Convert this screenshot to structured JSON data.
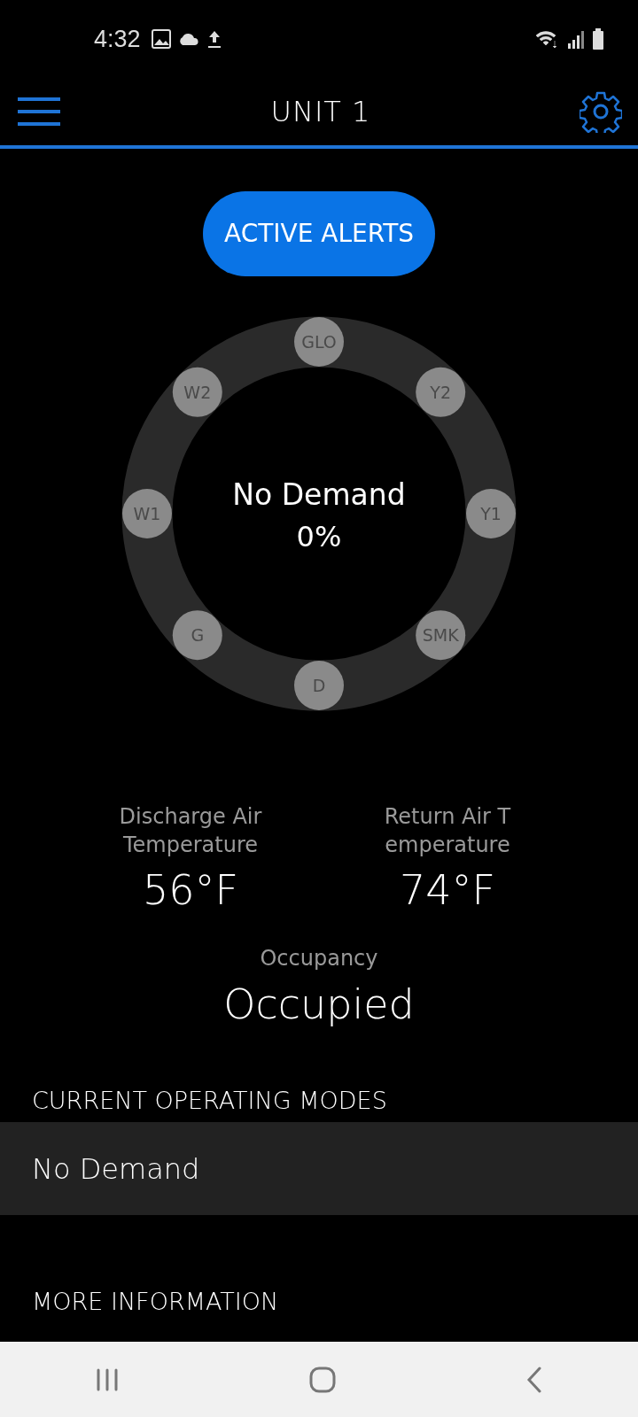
{
  "status_bar": {
    "time": "4:32"
  },
  "header": {
    "title": "UNIT 1"
  },
  "alerts_button": {
    "label": "ACTIVE ALERTS"
  },
  "demand_ring": {
    "status": "No Demand",
    "percent": "0%",
    "nodes": [
      {
        "label": "GLO",
        "active": false
      },
      {
        "label": "Y2",
        "active": false
      },
      {
        "label": "Y1",
        "active": false
      },
      {
        "label": "SMK",
        "active": false
      },
      {
        "label": "D",
        "active": false
      },
      {
        "label": "G",
        "active": false
      },
      {
        "label": "W1",
        "active": false
      },
      {
        "label": "W2",
        "active": false
      }
    ]
  },
  "readings": [
    {
      "label": "Discharge Air\nTemperature",
      "value": "56°F"
    },
    {
      "label": "Return Air T\nemperature",
      "value": "74°F"
    }
  ],
  "occupancy": {
    "label": "Occupancy",
    "value": "Occupied"
  },
  "operating_modes": {
    "heading": "CURRENT OPERATING MODES",
    "items": [
      "No Demand"
    ]
  },
  "more_information": {
    "heading": "MORE INFORMATION"
  }
}
